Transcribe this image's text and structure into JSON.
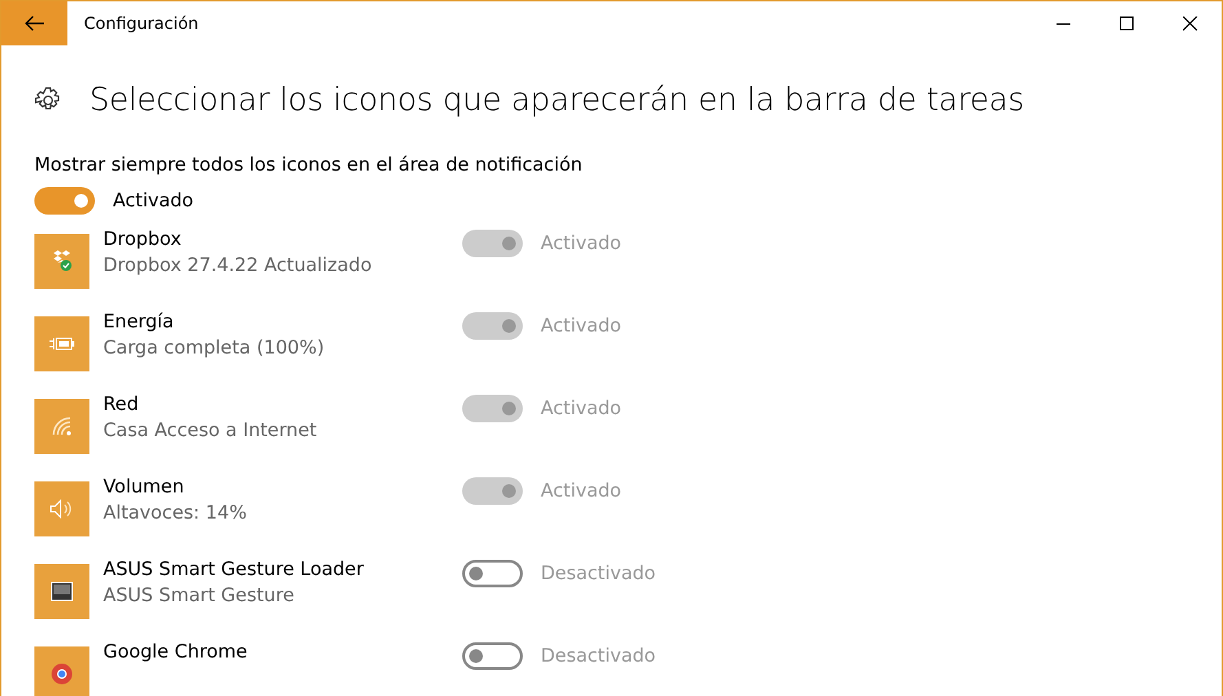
{
  "window": {
    "title": "Configuración"
  },
  "heading": "Seleccionar los iconos que aparecerán en la barra de tareas",
  "always_show": {
    "label": "Mostrar siempre todos los iconos en el área de notificación",
    "on": true,
    "state_text": "Activado"
  },
  "items": [
    {
      "name": "Dropbox",
      "detail": "Dropbox 27.4.22 Actualizado",
      "on": true,
      "disabled": true,
      "state_text": "Activado"
    },
    {
      "name": "Energía",
      "detail": "Carga completa (100%)",
      "on": true,
      "disabled": true,
      "state_text": "Activado"
    },
    {
      "name": "Red",
      "detail": "Casa Acceso a Internet",
      "on": true,
      "disabled": true,
      "state_text": "Activado"
    },
    {
      "name": "Volumen",
      "detail": "Altavoces: 14%",
      "on": true,
      "disabled": true,
      "state_text": "Activado"
    },
    {
      "name": "ASUS Smart Gesture Loader",
      "detail": "ASUS Smart Gesture",
      "on": false,
      "disabled": false,
      "state_text": "Desactivado"
    },
    {
      "name": "Google Chrome",
      "on": false,
      "disabled": false,
      "state_text": "Desactivado"
    }
  ]
}
